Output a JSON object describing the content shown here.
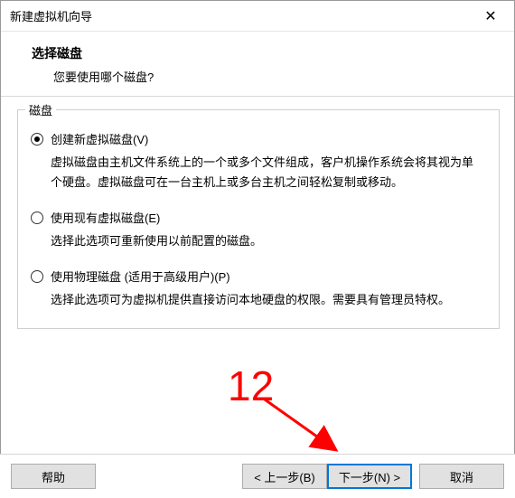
{
  "titlebar": {
    "title": "新建虚拟机向导"
  },
  "header": {
    "title": "选择磁盘",
    "desc": "您要使用哪个磁盘?"
  },
  "group": {
    "label": "磁盘"
  },
  "options": {
    "create": {
      "label": "创建新虚拟磁盘(V)",
      "desc": "虚拟磁盘由主机文件系统上的一个或多个文件组成，客户机操作系统会将其视为单个硬盘。虚拟磁盘可在一台主机上或多台主机之间轻松复制或移动。"
    },
    "existing": {
      "label": "使用现有虚拟磁盘(E)",
      "desc": "选择此选项可重新使用以前配置的磁盘。"
    },
    "physical": {
      "label": "使用物理磁盘 (适用于高级用户)(P)",
      "desc": "选择此选项可为虚拟机提供直接访问本地硬盘的权限。需要具有管理员特权。"
    }
  },
  "buttons": {
    "help": "帮助",
    "back": "< 上一步(B)",
    "next": "下一步(N) >",
    "cancel": "取消"
  },
  "annotation": {
    "number": "12"
  }
}
